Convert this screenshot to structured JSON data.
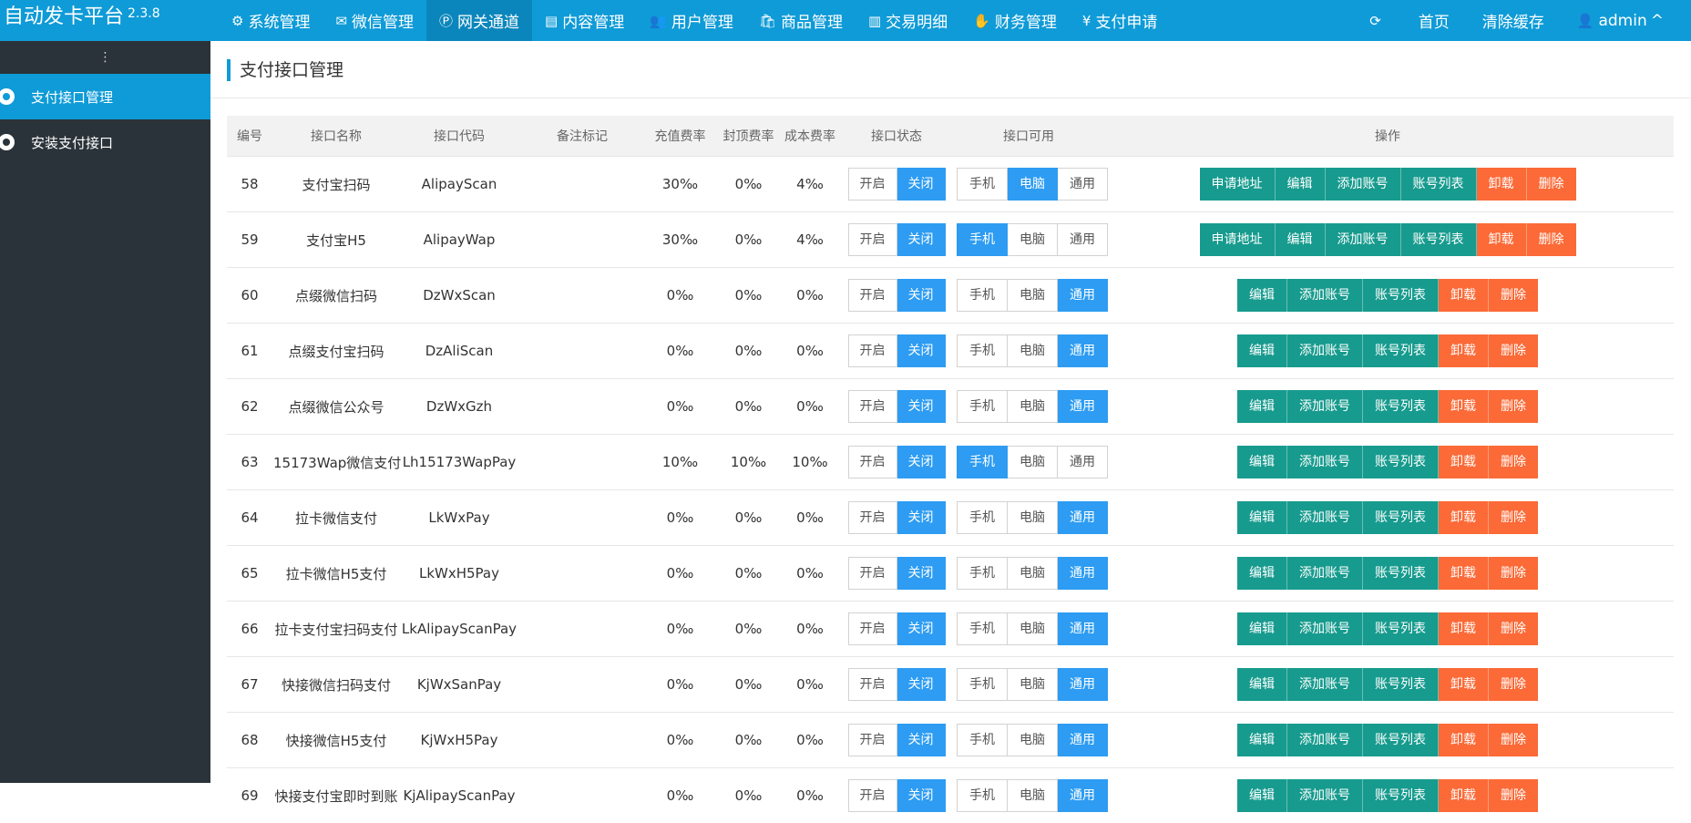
{
  "app": {
    "title": "自动发卡平台",
    "version": "2.3.8"
  },
  "nav": [
    {
      "label": "系统管理",
      "icon": "gear-icon",
      "glyph": "⚙"
    },
    {
      "label": "微信管理",
      "icon": "wechat-icon",
      "glyph": "✉"
    },
    {
      "label": "网关通道",
      "icon": "paypal-icon",
      "glyph": "Ⓟ"
    },
    {
      "label": "内容管理",
      "icon": "file-icon",
      "glyph": "▤"
    },
    {
      "label": "用户管理",
      "icon": "users-icon",
      "glyph": "👥"
    },
    {
      "label": "商品管理",
      "icon": "shopping-bag-icon",
      "glyph": "🛍"
    },
    {
      "label": "交易明细",
      "icon": "bar-chart-icon",
      "glyph": "▥"
    },
    {
      "label": "财务管理",
      "icon": "handshake-icon",
      "glyph": "✋"
    },
    {
      "label": "支付申请",
      "icon": "yen-icon",
      "glyph": "¥"
    }
  ],
  "nav_right": {
    "refresh_glyph": "⟳",
    "home": "首页",
    "clear_cache": "清除缓存",
    "user": "admin",
    "user_glyph": "👤",
    "caret": "^"
  },
  "sidebar": {
    "toggle": "⋮",
    "items": [
      {
        "label": "支付接口管理"
      },
      {
        "label": "安装支付接口"
      }
    ]
  },
  "page": {
    "title": "支付接口管理"
  },
  "table": {
    "headers": [
      "编号",
      "接口名称",
      "接口代码",
      "备注标记",
      "充值费率",
      "封顶费率",
      "成本费率",
      "接口状态",
      "接口可用",
      "操作"
    ],
    "status_labels": [
      "开启",
      "关闭"
    ],
    "avail_labels": [
      "手机",
      "电脑",
      "通用"
    ],
    "ops_labels": {
      "apply": "申请地址",
      "edit": "编辑",
      "add_account": "添加账号",
      "account_list": "账号列表",
      "unload": "卸载",
      "delete": "删除"
    },
    "rows": [
      {
        "id": "58",
        "name": "支付宝扫码",
        "code": "AlipayScan",
        "note": "",
        "rate": "30‰",
        "cap": "0‰",
        "cost": "4‰",
        "status": "关闭",
        "avail": "电脑",
        "apply": true
      },
      {
        "id": "59",
        "name": "支付宝H5",
        "code": "AlipayWap",
        "note": "",
        "rate": "30‰",
        "cap": "0‰",
        "cost": "4‰",
        "status": "关闭",
        "avail": "手机",
        "apply": true
      },
      {
        "id": "60",
        "name": "点缀微信扫码",
        "code": "DzWxScan",
        "note": "",
        "rate": "0‰",
        "cap": "0‰",
        "cost": "0‰",
        "status": "关闭",
        "avail": "通用",
        "apply": false
      },
      {
        "id": "61",
        "name": "点缀支付宝扫码",
        "code": "DzAliScan",
        "note": "",
        "rate": "0‰",
        "cap": "0‰",
        "cost": "0‰",
        "status": "关闭",
        "avail": "通用",
        "apply": false
      },
      {
        "id": "62",
        "name": "点缀微信公众号",
        "code": "DzWxGzh",
        "note": "",
        "rate": "0‰",
        "cap": "0‰",
        "cost": "0‰",
        "status": "关闭",
        "avail": "通用",
        "apply": false
      },
      {
        "id": "63",
        "name": "15173Wap微信支付",
        "code": "Lh15173WapPay",
        "note": "",
        "rate": "10‰",
        "cap": "10‰",
        "cost": "10‰",
        "status": "关闭",
        "avail": "手机",
        "apply": false
      },
      {
        "id": "64",
        "name": "拉卡微信支付",
        "code": "LkWxPay",
        "note": "",
        "rate": "0‰",
        "cap": "0‰",
        "cost": "0‰",
        "status": "关闭",
        "avail": "通用",
        "apply": false
      },
      {
        "id": "65",
        "name": "拉卡微信H5支付",
        "code": "LkWxH5Pay",
        "note": "",
        "rate": "0‰",
        "cap": "0‰",
        "cost": "0‰",
        "status": "关闭",
        "avail": "通用",
        "apply": false
      },
      {
        "id": "66",
        "name": "拉卡支付宝扫码支付",
        "code": "LkAlipayScanPay",
        "note": "",
        "rate": "0‰",
        "cap": "0‰",
        "cost": "0‰",
        "status": "关闭",
        "avail": "通用",
        "apply": false
      },
      {
        "id": "67",
        "name": "快接微信扫码支付",
        "code": "KjWxSanPay",
        "note": "",
        "rate": "0‰",
        "cap": "0‰",
        "cost": "0‰",
        "status": "关闭",
        "avail": "通用",
        "apply": false
      },
      {
        "id": "68",
        "name": "快接微信H5支付",
        "code": "KjWxH5Pay",
        "note": "",
        "rate": "0‰",
        "cap": "0‰",
        "cost": "0‰",
        "status": "关闭",
        "avail": "通用",
        "apply": false
      },
      {
        "id": "69",
        "name": "快接支付宝即时到账",
        "code": "KjAlipayScanPay",
        "note": "",
        "rate": "0‰",
        "cap": "0‰",
        "cost": "0‰",
        "status": "关闭",
        "avail": "通用",
        "apply": false
      }
    ]
  },
  "colors": {
    "primary": "#0f9bd7",
    "sidebar": "#2b333a",
    "toggle_on": "#2d9cf2",
    "ops_green": "#179b8e",
    "ops_orange": "#fb6a37"
  }
}
